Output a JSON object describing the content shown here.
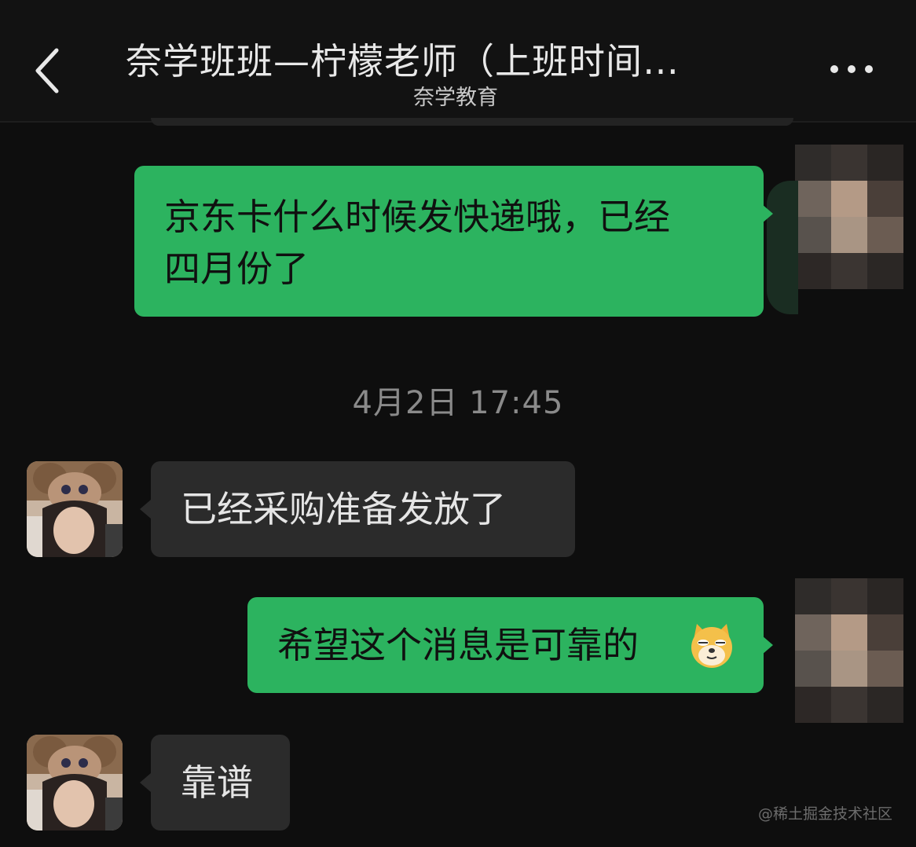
{
  "header": {
    "title": "奈学班班—柠檬老师（上班时间…",
    "subtitle": "奈学教育"
  },
  "icons": {
    "back": "chevron-left-icon",
    "more": "more-dots-icon",
    "emoji": "doge-emoji-icon"
  },
  "messages": [
    {
      "side": "sent",
      "text_line1": "京东卡什么时候发快递哦，已经",
      "text_line2": "四月份了"
    },
    {
      "side": "recv",
      "text": "已经采购准备发放了"
    },
    {
      "side": "sent",
      "text": "希望这个消息是可靠的"
    },
    {
      "side": "recv",
      "text": "靠谱"
    }
  ],
  "timestamp": "4月2日 17:45",
  "watermark": "@稀土掘金技术社区",
  "colors": {
    "sent_bubble": "#2cb35f",
    "recv_bubble": "#2b2b2b",
    "background": "#0e0e0e"
  }
}
